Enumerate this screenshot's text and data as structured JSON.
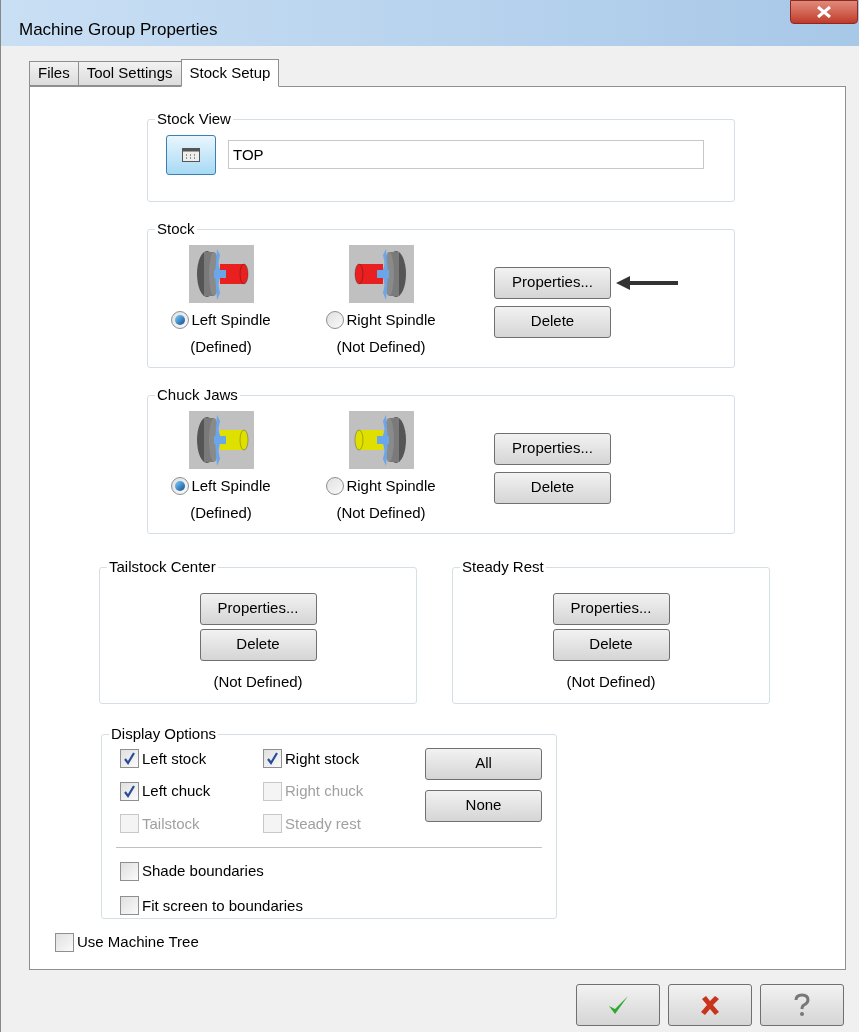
{
  "window": {
    "title": "Machine Group Properties"
  },
  "tabs": [
    {
      "label": "Files",
      "selected": false
    },
    {
      "label": "Tool Settings",
      "selected": false
    },
    {
      "label": "Stock Setup",
      "selected": true
    }
  ],
  "stock_view": {
    "title": "Stock View",
    "value": "TOP"
  },
  "stock": {
    "title": "Stock",
    "spindles": [
      {
        "kind": "left",
        "label": "Left Spindle",
        "status": "(Defined)",
        "selected": true
      },
      {
        "kind": "right",
        "label": "Right Spindle",
        "status": "(Not Defined)",
        "selected": false
      }
    ],
    "buttons": [
      "Properties...",
      "Delete"
    ]
  },
  "chuck_jaws": {
    "title": "Chuck Jaws",
    "spindles": [
      {
        "kind": "left",
        "label": "Left Spindle",
        "status": "(Defined)",
        "selected": true
      },
      {
        "kind": "right",
        "label": "Right Spindle",
        "status": "(Not Defined)",
        "selected": false
      }
    ],
    "buttons": [
      "Properties...",
      "Delete"
    ]
  },
  "tailstock_center": {
    "title": "Tailstock Center",
    "buttons": [
      "Properties...",
      "Delete"
    ],
    "status": "(Not Defined)"
  },
  "steady_rest": {
    "title": "Steady Rest",
    "buttons": [
      "Properties...",
      "Delete"
    ],
    "status": "(Not Defined)"
  },
  "display_options": {
    "title": "Display Options",
    "checkboxes": [
      {
        "label": "Left stock",
        "checked": true,
        "disabled": false
      },
      {
        "label": "Right stock",
        "checked": true,
        "disabled": false
      },
      {
        "label": "Left chuck",
        "checked": true,
        "disabled": false
      },
      {
        "label": "Right chuck",
        "checked": false,
        "disabled": true
      },
      {
        "label": "Tailstock",
        "checked": false,
        "disabled": true
      },
      {
        "label": "Steady rest",
        "checked": false,
        "disabled": true
      }
    ],
    "buttons": [
      "All",
      "None"
    ],
    "options": [
      {
        "label": "Shade boundaries",
        "checked": false
      },
      {
        "label": "Fit screen to boundaries",
        "checked": false
      }
    ]
  },
  "use_machine_tree": {
    "label": "Use Machine Tree",
    "checked": false
  },
  "footer_buttons": [
    {
      "kind": "ok"
    },
    {
      "kind": "cancel"
    },
    {
      "kind": "help"
    }
  ]
}
